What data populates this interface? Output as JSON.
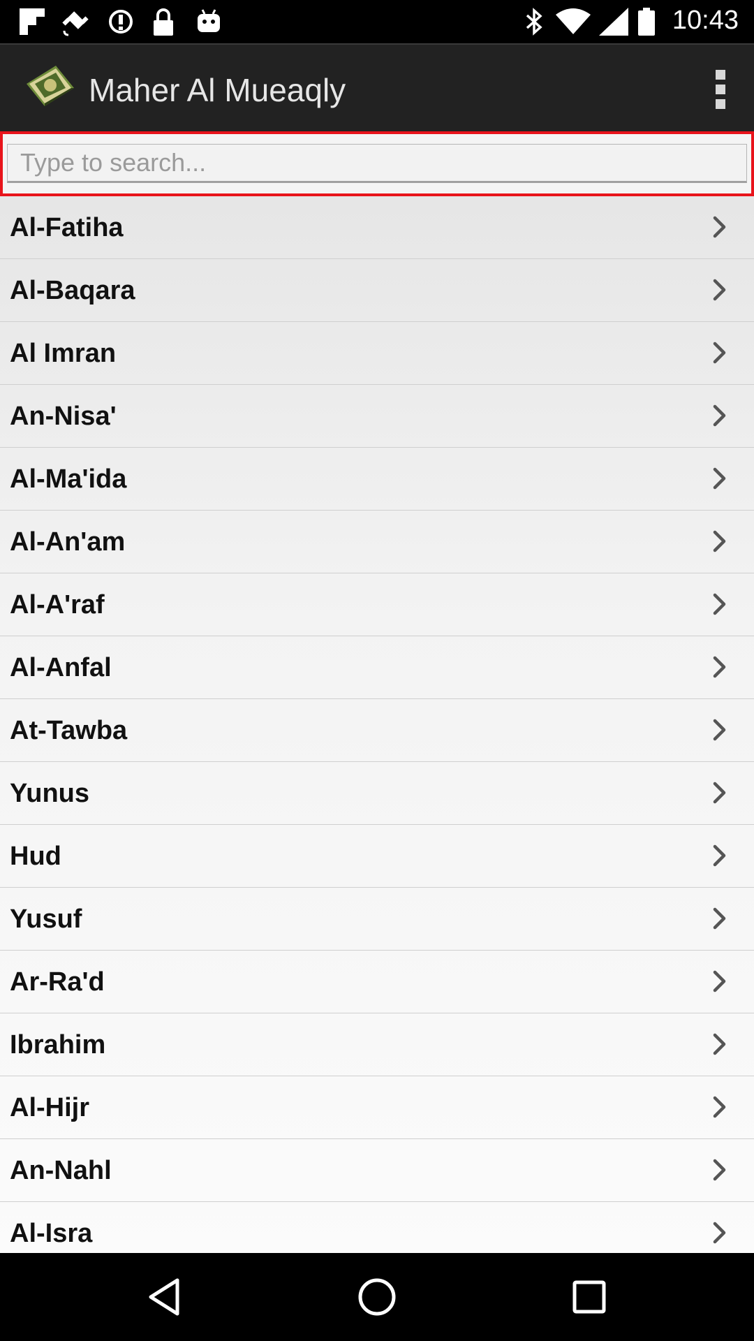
{
  "status_bar": {
    "time": "10:43",
    "left_icons": [
      "flipboard-icon",
      "fake-gps-icon",
      "data-saver-icon",
      "lock-icon",
      "android-icon"
    ],
    "right_icons": [
      "bluetooth-icon",
      "wifi-icon",
      "signal-icon",
      "battery-icon"
    ]
  },
  "action_bar": {
    "title": "Maher Al Mueaqly",
    "logo_icon": "quran-book-icon",
    "menu_icon": "overflow-menu-icon"
  },
  "search": {
    "placeholder": "Type to search...",
    "value": "",
    "highlight_color": "#e8141b"
  },
  "surahs": [
    {
      "label": "Al-Fatiha"
    },
    {
      "label": "Al-Baqara"
    },
    {
      "label": "Al Imran"
    },
    {
      "label": "An-Nisa'"
    },
    {
      "label": "Al-Ma'ida"
    },
    {
      "label": "Al-An'am"
    },
    {
      "label": "Al-A'raf"
    },
    {
      "label": "Al-Anfal"
    },
    {
      "label": "At-Tawba"
    },
    {
      "label": "Yunus"
    },
    {
      "label": "Hud"
    },
    {
      "label": "Yusuf"
    },
    {
      "label": "Ar-Ra'd"
    },
    {
      "label": "Ibrahim"
    },
    {
      "label": "Al-Hijr"
    },
    {
      "label": "An-Nahl"
    },
    {
      "label": "Al-Isra"
    }
  ],
  "nav_bar": {
    "buttons": [
      "back-icon",
      "home-icon",
      "recents-icon"
    ]
  }
}
